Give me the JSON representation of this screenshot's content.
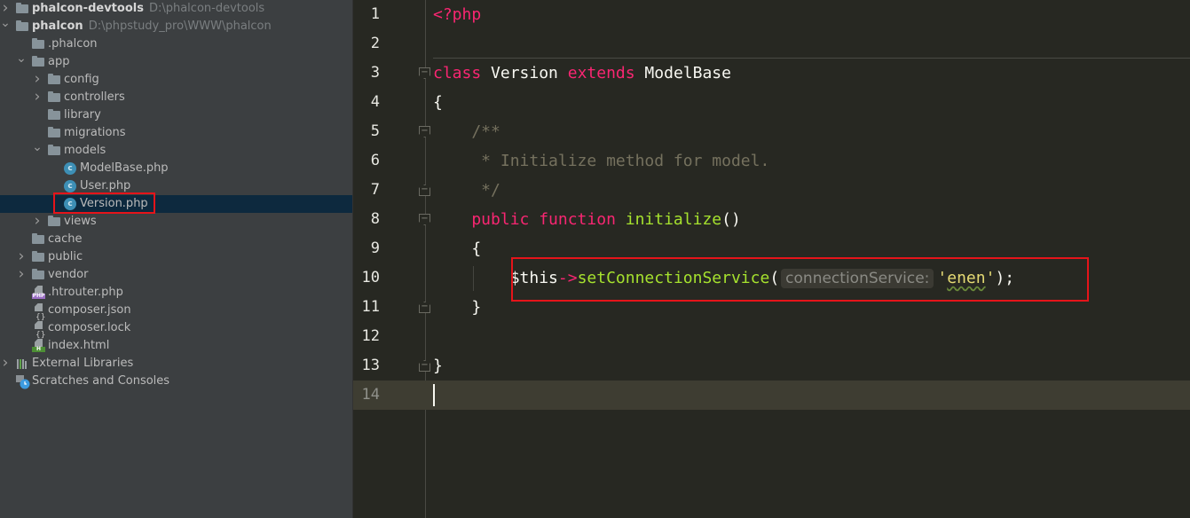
{
  "project_tree": {
    "items": [
      {
        "label": "phalcon-devtools",
        "path": "D:\\phalcon-devtools",
        "type": "root-folder",
        "chevron": ">",
        "depth": 0
      },
      {
        "label": "phalcon",
        "path": "D:\\phpstudy_pro\\WWW\\phalcon",
        "type": "root-folder",
        "chevron": "v",
        "depth": 0
      },
      {
        "label": ".phalcon",
        "type": "folder",
        "chevron": "",
        "depth": 1
      },
      {
        "label": "app",
        "type": "folder",
        "chevron": "v",
        "depth": 1
      },
      {
        "label": "config",
        "type": "folder",
        "chevron": ">",
        "depth": 2
      },
      {
        "label": "controllers",
        "type": "folder",
        "chevron": ">",
        "depth": 2
      },
      {
        "label": "library",
        "type": "folder",
        "chevron": "",
        "depth": 2
      },
      {
        "label": "migrations",
        "type": "folder",
        "chevron": "",
        "depth": 2
      },
      {
        "label": "models",
        "type": "folder",
        "chevron": "v",
        "depth": 2
      },
      {
        "label": "ModelBase.php",
        "type": "php-class",
        "chevron": "",
        "depth": 3
      },
      {
        "label": "User.php",
        "type": "php-class",
        "chevron": "",
        "depth": 3
      },
      {
        "label": "Version.php",
        "type": "php-class",
        "chevron": "",
        "depth": 3,
        "selected": true
      },
      {
        "label": "views",
        "type": "folder",
        "chevron": ">",
        "depth": 2
      },
      {
        "label": "cache",
        "type": "folder",
        "chevron": "",
        "depth": 1
      },
      {
        "label": "public",
        "type": "folder",
        "chevron": ">",
        "depth": 1
      },
      {
        "label": "vendor",
        "type": "folder",
        "chevron": ">",
        "depth": 1
      },
      {
        "label": ".htrouter.php",
        "type": "php-file",
        "chevron": "",
        "depth": 1
      },
      {
        "label": "composer.json",
        "type": "composer-file",
        "chevron": "",
        "depth": 1
      },
      {
        "label": "composer.lock",
        "type": "composer-file",
        "chevron": "",
        "depth": 1
      },
      {
        "label": "index.html",
        "type": "html-file",
        "chevron": "",
        "depth": 1
      },
      {
        "label": "External Libraries",
        "type": "libraries",
        "chevron": ">",
        "depth": 0
      },
      {
        "label": "Scratches and Consoles",
        "type": "scratches",
        "chevron": "",
        "depth": 0
      }
    ],
    "icon_tags": {
      "php": "PHP",
      "html": "H",
      "class": "c"
    }
  },
  "editor": {
    "file": "Version.php",
    "current_line": 14,
    "lines": [
      {
        "n": "1",
        "tokens": [
          {
            "t": "<?php",
            "c": "kw"
          }
        ]
      },
      {
        "n": "2",
        "tokens": []
      },
      {
        "n": "3",
        "tokens": [
          {
            "t": "class",
            "c": "kw"
          },
          {
            "t": " Version ",
            "c": "cls"
          },
          {
            "t": "extends",
            "c": "kw"
          },
          {
            "t": " ModelBase",
            "c": "cls"
          }
        ]
      },
      {
        "n": "4",
        "tokens": [
          {
            "t": "{",
            "c": "cls"
          }
        ]
      },
      {
        "n": "5",
        "tokens": [
          {
            "t": "    /**",
            "c": "cmt"
          }
        ]
      },
      {
        "n": "6",
        "tokens": [
          {
            "t": "     * Initialize method for model.",
            "c": "cmt"
          }
        ]
      },
      {
        "n": "7",
        "tokens": [
          {
            "t": "     */",
            "c": "cmt"
          }
        ]
      },
      {
        "n": "8",
        "tokens": [
          {
            "t": "    public function ",
            "c": "kw"
          },
          {
            "t": "initialize",
            "c": "fn"
          },
          {
            "t": "()",
            "c": "cls"
          }
        ]
      },
      {
        "n": "9",
        "tokens": [
          {
            "t": "    {",
            "c": "cls"
          }
        ]
      },
      {
        "n": "10",
        "tokens": [
          {
            "t": "        $this",
            "c": "cls"
          },
          {
            "t": "->",
            "c": "kw"
          },
          {
            "t": "setConnectionService",
            "c": "fn"
          },
          {
            "t": "(",
            "c": "cls"
          },
          {
            "t": "connectionService:",
            "c": "hint"
          },
          {
            "t": "'",
            "c": "str"
          },
          {
            "t": "enen",
            "c": "str squig"
          },
          {
            "t": "'",
            "c": "str"
          },
          {
            "t": ");",
            "c": "cls"
          }
        ]
      },
      {
        "n": "11",
        "tokens": [
          {
            "t": "    }",
            "c": "cls"
          }
        ]
      },
      {
        "n": "12",
        "tokens": []
      },
      {
        "n": "13",
        "tokens": [
          {
            "t": "}",
            "c": "cls"
          }
        ]
      },
      {
        "n": "14",
        "tokens": []
      }
    ],
    "fold_markers": {
      "3": "open",
      "5": "open",
      "7": "close",
      "8": "open",
      "11": "close",
      "13": "close"
    }
  },
  "annotations": {
    "highlight_color": "#e5141a",
    "boxes": [
      "Version.php tree item",
      "line 10 setConnectionService call"
    ]
  }
}
